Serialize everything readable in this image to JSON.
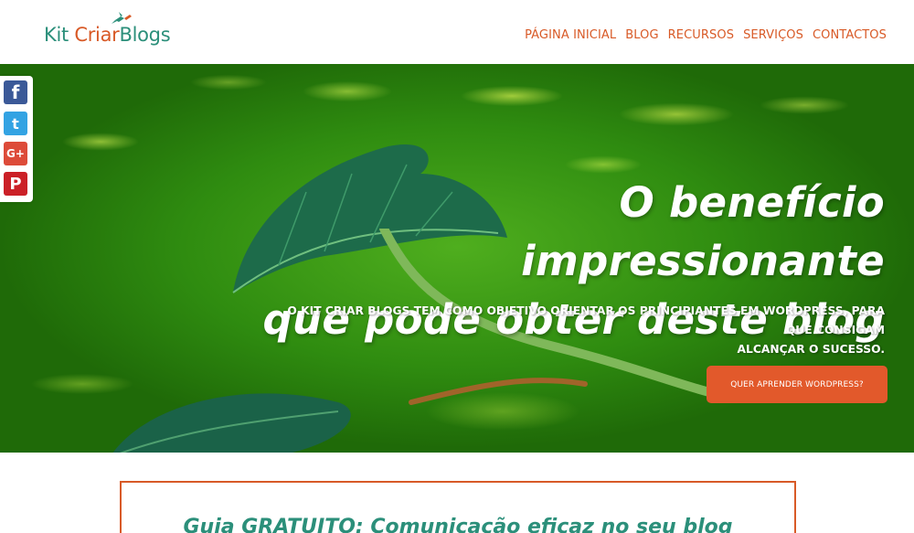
{
  "brand": {
    "logo_word1": "Kit",
    "logo_word2": "Criar",
    "logo_word3": "Blogs",
    "colors": {
      "teal": "#2b8f7a",
      "orange": "#d85a27"
    }
  },
  "nav": {
    "items": [
      {
        "label": "PÁGINA INICIAL"
      },
      {
        "label": "BLOG"
      },
      {
        "label": "RECURSOS"
      },
      {
        "label": "SERVIÇOS"
      },
      {
        "label": "CONTACTOS"
      }
    ]
  },
  "social": {
    "items": [
      {
        "icon": "facebook-icon",
        "glyph": "f"
      },
      {
        "icon": "twitter-icon",
        "glyph": "t"
      },
      {
        "icon": "google-plus-icon",
        "glyph": "G+"
      },
      {
        "icon": "pinterest-icon",
        "glyph": "P"
      }
    ]
  },
  "hero": {
    "title_line1": "O benefício impressionante",
    "title_line2": "que pode obter deste blog",
    "subtitle_line1": "O KIT CRIAR BLOGS TEM COMO OBJETIVO ORIENTAR OS PRINCIPIANTES EM WORDPRESS, PARA QUE CONSIGAM",
    "subtitle_line2": "ALCANÇAR O SUCESSO.",
    "cta_label": "QUER APRENDER WORDPRESS?"
  },
  "guide": {
    "title": "Guia GRATUITO: Comunicação eficaz no seu blog"
  }
}
